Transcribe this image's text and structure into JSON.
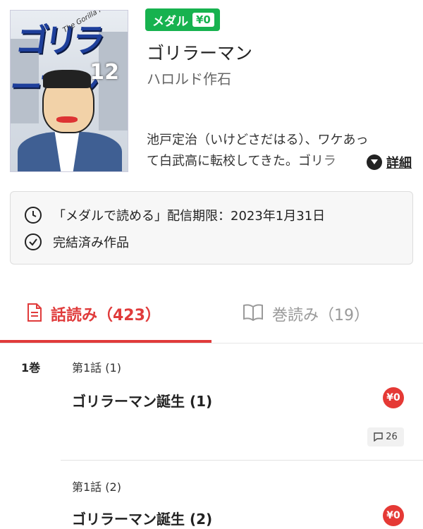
{
  "book": {
    "cover_title_art": "ゴリラーマン",
    "cover_subtitle_art": "The Gorilla Man",
    "cover_volume_art": "12",
    "medal_label": "メダル",
    "medal_price": "¥0",
    "title": "ゴリラーマン",
    "author": "ハロルド作石",
    "description_line1": "池戸定治（いけどさだはる）、ワケあっ",
    "description_line2": "て白武高に転校してきた。ゴリラ",
    "detail_link": "詳細"
  },
  "info": {
    "deadline": "「メダルで読める」配信期限：2023年1月31日",
    "completed": "完結済み作品"
  },
  "tabs": [
    {
      "label": "話読み（423）",
      "active": true
    },
    {
      "label": "巻読み（19）",
      "active": false
    }
  ],
  "list": {
    "volume_label": "1巻",
    "episodes": [
      {
        "number": "第1話 (1)",
        "title": "ゴリラーマン誕生 (1)",
        "price": "¥0",
        "comments": "26"
      },
      {
        "number": "第1話 (2)",
        "title": "ゴリラーマン誕生 (2)",
        "price": "¥0"
      }
    ]
  },
  "colors": {
    "accent_red": "#e03b3b",
    "medal_green": "#17b24f"
  },
  "icons": [
    "doc-icon",
    "book-icon",
    "clock-icon",
    "check-circle-icon",
    "chevron-down-icon",
    "comment-icon"
  ]
}
